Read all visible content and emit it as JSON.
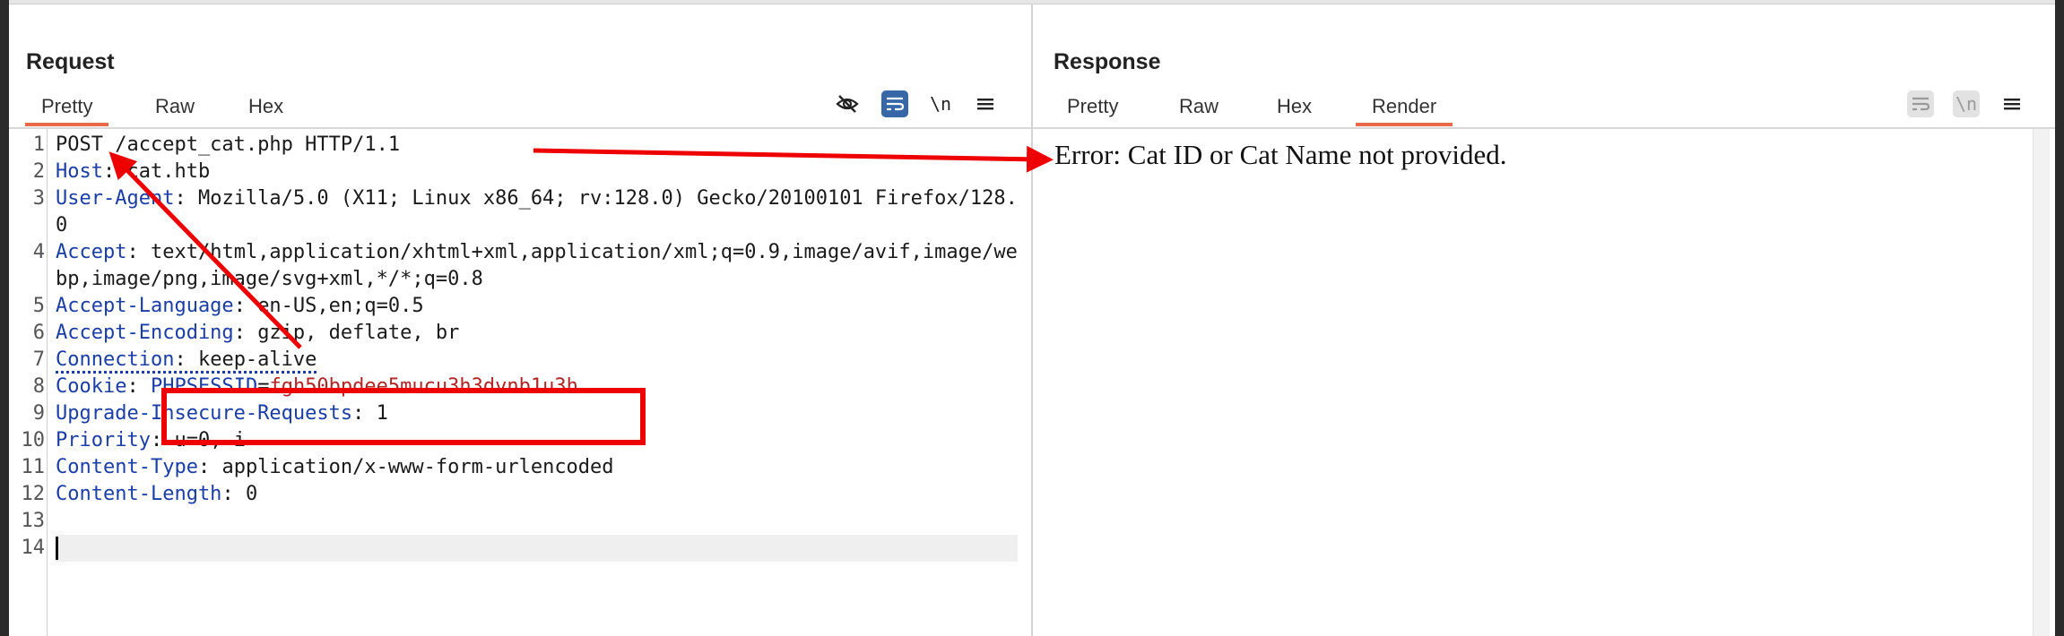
{
  "request": {
    "title": "Request",
    "tabs": [
      "Pretty",
      "Raw",
      "Hex"
    ],
    "active_tab": "Pretty",
    "toolbar": {
      "eye_icon": "eye-off-icon",
      "wrap_icon": "wrap-icon",
      "newline_label": "\\n",
      "menu_icon": "menu-icon"
    },
    "lines": [
      {
        "n": "1",
        "name": "",
        "sep": "",
        "value": "POST /accept_cat.php HTTP/1.1"
      },
      {
        "n": "2",
        "name": "Host",
        "sep": ": ",
        "value": "cat.htb"
      },
      {
        "n": "3",
        "name": "User-Agent",
        "sep": ": ",
        "value": "Mozilla/5.0 (X11; Linux x86_64; rv:128.0) Gecko/20100101 Firefox/128.0"
      },
      {
        "n": "4",
        "name": "Accept",
        "sep": ": ",
        "value": "text/html,application/xhtml+xml,application/xml;q=0.9,image/avif,image/webp,image/png,image/svg+xml,*/*;q=0.8"
      },
      {
        "n": "5",
        "name": "Accept-Language",
        "sep": ": ",
        "value": "en-US,en;q=0.5"
      },
      {
        "n": "6",
        "name": "Accept-Encoding",
        "sep": ": ",
        "value": "gzip, deflate, br"
      },
      {
        "n": "7",
        "name": "Connection",
        "sep": ": ",
        "value": "keep-alive"
      },
      {
        "n": "8",
        "name": "Cookie",
        "sep": ": ",
        "value": ""
      },
      {
        "n": "9",
        "name": "Upgrade-Insecure-Requests",
        "sep": ": ",
        "value": "1"
      },
      {
        "n": "10",
        "name": "Priority",
        "sep": ": ",
        "value": "u=0, i"
      },
      {
        "n": "11",
        "name": "Content-Type",
        "sep": ": ",
        "value": "application/x-www-form-urlencoded"
      },
      {
        "n": "12",
        "name": "Content-Length",
        "sep": ": ",
        "value": "0"
      },
      {
        "n": "13",
        "name": "",
        "sep": "",
        "value": ""
      },
      {
        "n": "14",
        "name": "",
        "sep": "",
        "value": ""
      }
    ],
    "cookie": {
      "name": "PHPSESSID",
      "eq": "=",
      "value": "fgh50bpdee5mucu3h3dvnb1u3h"
    }
  },
  "response": {
    "title": "Response",
    "tabs": [
      "Pretty",
      "Raw",
      "Hex",
      "Render"
    ],
    "active_tab": "Render",
    "toolbar": {
      "wrap_icon": "wrap-icon",
      "newline_label": "\\n",
      "menu_icon": "menu-icon"
    },
    "body_text": "Error: Cat ID or Cat Name not provided."
  },
  "layout_modes": [
    "side-by-side-icon",
    "horizontal-split-icon",
    "single-pane-icon"
  ],
  "colors": {
    "accent": "#e8684a",
    "header_name": "#1a3ea5",
    "cookie_value": "#b02525",
    "annotation": "#ee0000",
    "active_button": "#3867a8"
  }
}
